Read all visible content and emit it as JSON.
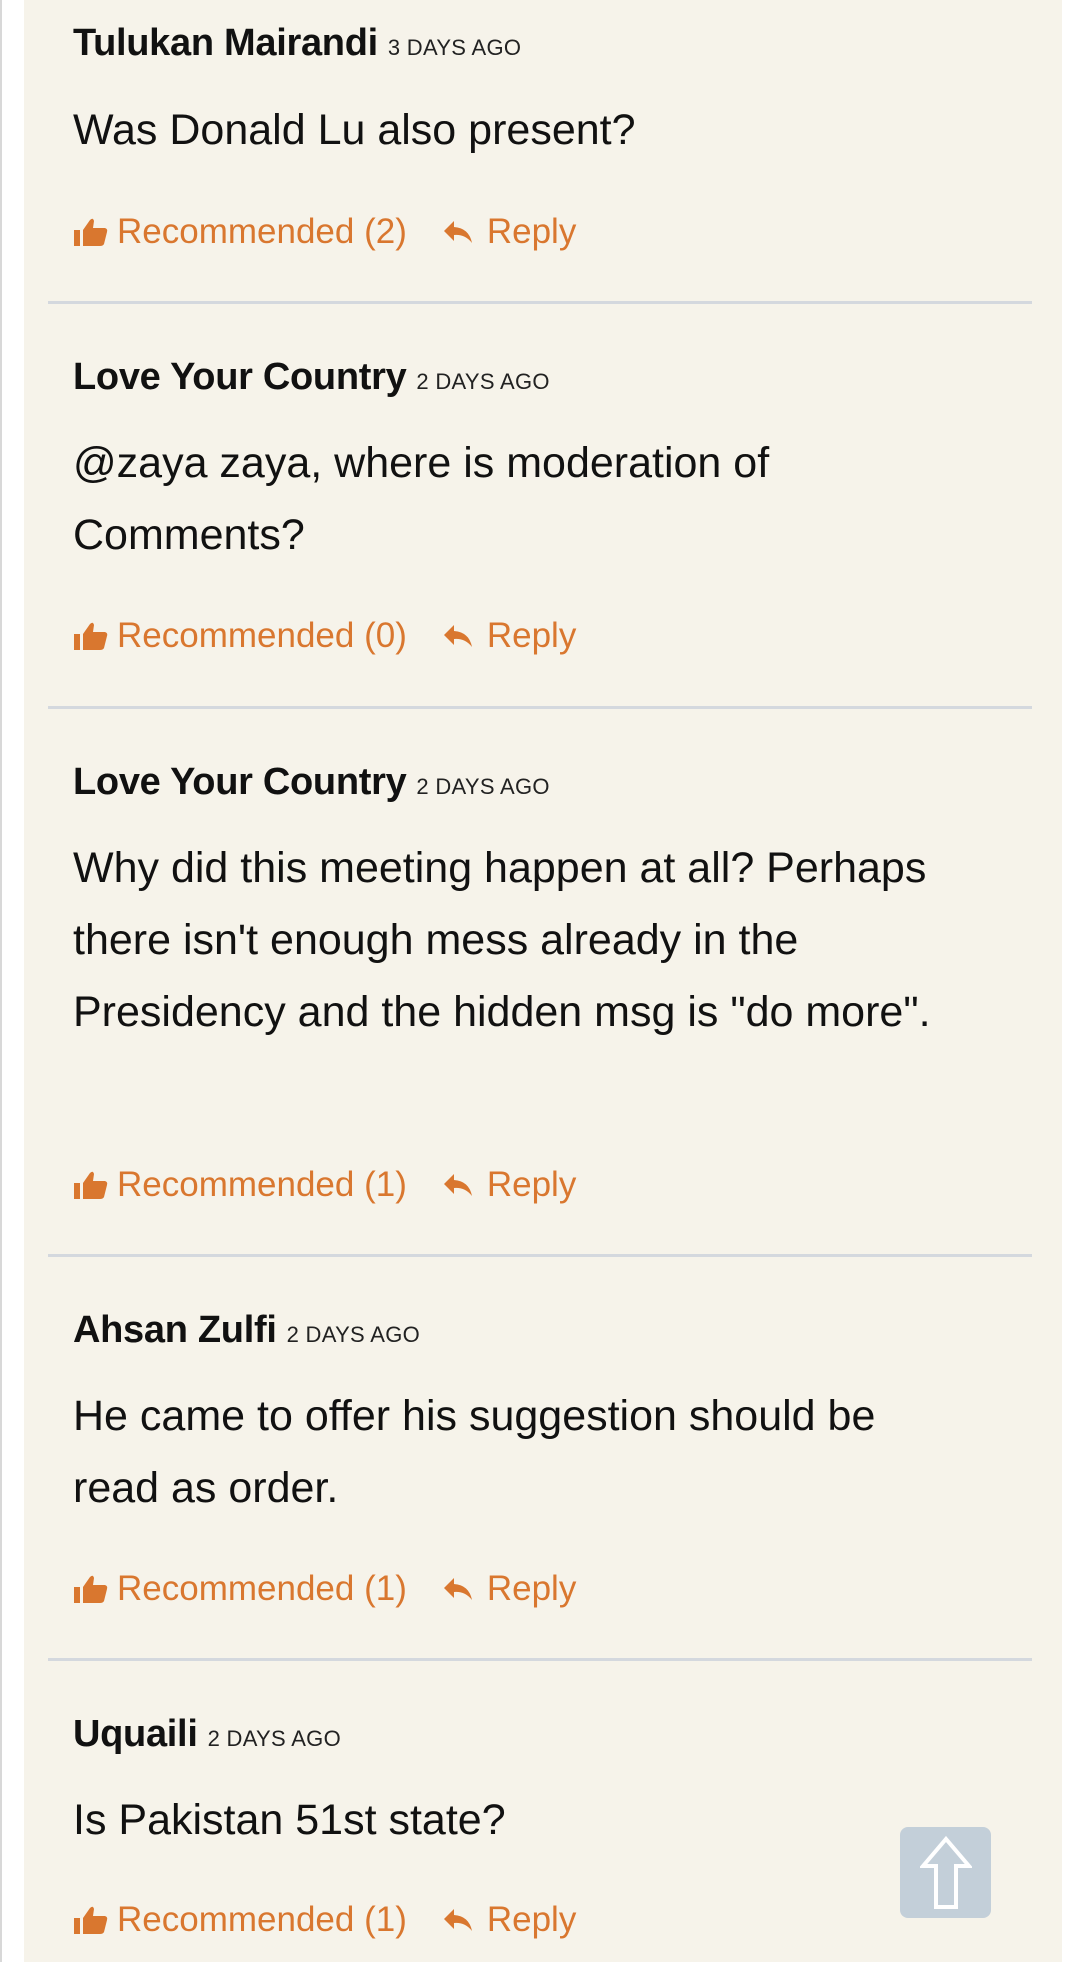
{
  "comments": [
    {
      "author": "Tulukan Mairandi",
      "time": "3 DAYS AGO",
      "text": "Was Donald Lu also present?",
      "recommended": "Recommended (2)",
      "reply": "Reply"
    },
    {
      "author": "Love Your Country",
      "time": "2 DAYS AGO",
      "text": "@zaya zaya, where is moderation of Comments?",
      "recommended": "Recommended (0)",
      "reply": "Reply"
    },
    {
      "author": "Love Your Country",
      "time": "2 DAYS AGO",
      "text": "Why did this meeting happen at all? Perhaps there isn't enough mess already in the Presidency and the hidden msg is \"do more\".",
      "recommended": "Recommended (1)",
      "reply": "Reply"
    },
    {
      "author": "Ahsan Zulfi",
      "time": "2 DAYS AGO",
      "text": "He came to offer his suggestion should be read as order.",
      "recommended": "Recommended (1)",
      "reply": "Reply"
    },
    {
      "author": "Uquaili",
      "time": "2 DAYS AGO",
      "text": "Is Pakistan 51st state?",
      "recommended": "Recommended (1)",
      "reply": "Reply"
    }
  ],
  "icons": {
    "recommend": "thumbs-up-icon",
    "reply": "reply-arrow-icon",
    "scroll_top": "arrow-up-icon"
  },
  "colors": {
    "accent": "#d9772f",
    "background": "#f6f3ea",
    "divider": "#d4d8de",
    "scroll_button": "#c3cfd9"
  }
}
